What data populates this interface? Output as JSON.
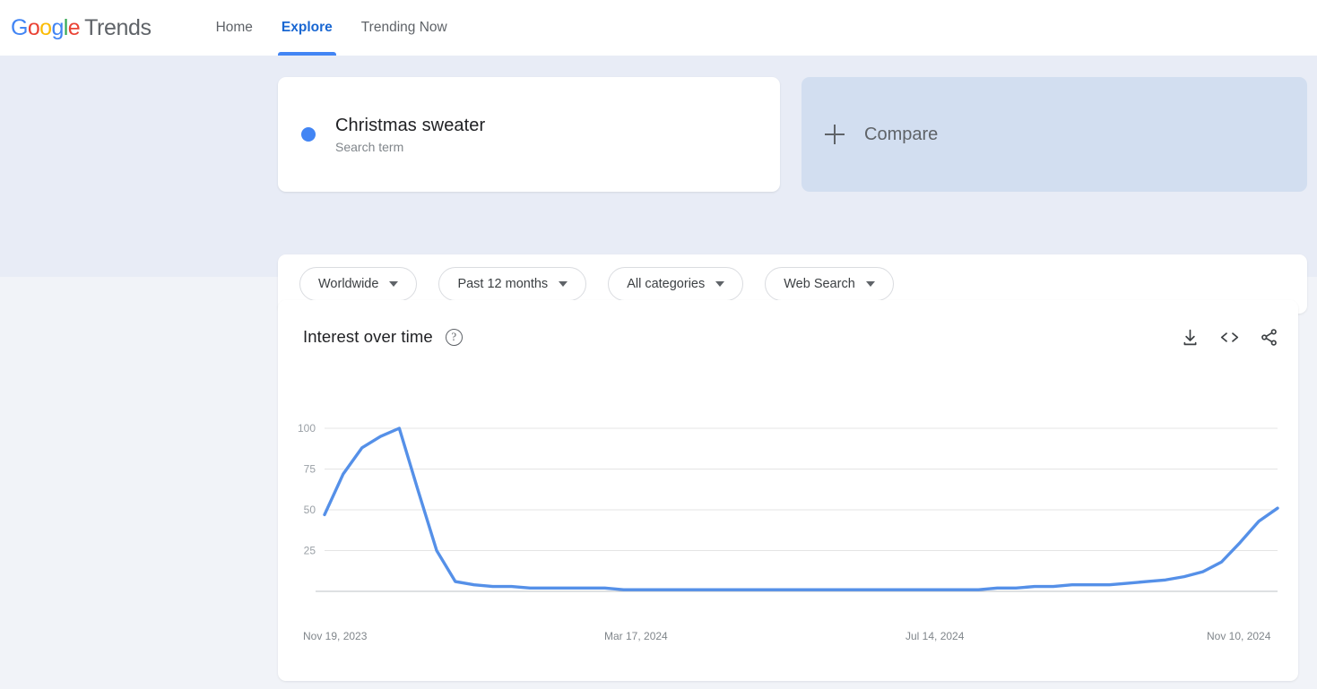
{
  "brand": {
    "logo_letters": [
      "G",
      "o",
      "o",
      "g",
      "l",
      "e"
    ],
    "word": "Trends"
  },
  "nav": {
    "items": [
      {
        "label": "Home",
        "active": false
      },
      {
        "label": "Explore",
        "active": true
      },
      {
        "label": "Trending Now",
        "active": false
      }
    ]
  },
  "query": {
    "term": {
      "title": "Christmas sweater",
      "subtitle": "Search term",
      "dot_color": "#4285f4"
    },
    "compare": {
      "label": "Compare",
      "icon": "plus-icon"
    }
  },
  "filters": [
    {
      "label": "Worldwide"
    },
    {
      "label": "Past 12 months"
    },
    {
      "label": "All categories"
    },
    {
      "label": "Web Search"
    }
  ],
  "chart_card": {
    "title": "Interest over time",
    "help_icon": "?",
    "actions": [
      {
        "name": "download-icon"
      },
      {
        "name": "embed-icon"
      },
      {
        "name": "share-icon"
      }
    ]
  },
  "chart_data": {
    "type": "line",
    "title": "Interest over time",
    "xlabel": "",
    "ylabel": "",
    "ylim": [
      0,
      100
    ],
    "yticks": [
      25,
      50,
      75,
      100
    ],
    "grid": true,
    "legend": false,
    "line_color": "#5590e8",
    "xticks": [
      "Nov 19, 2023",
      "Mar 17, 2024",
      "Jul 14, 2024",
      "Nov 10, 2024"
    ],
    "series": [
      {
        "name": "Christmas sweater",
        "color": "#5590e8",
        "x": [
          "Nov 19, 2023",
          "Nov 26, 2023",
          "Dec 3, 2023",
          "Dec 10, 2023",
          "Dec 17, 2023",
          "Dec 24, 2023",
          "Dec 31, 2023",
          "Jan 7, 2024",
          "Jan 14, 2024",
          "Jan 21, 2024",
          "Jan 28, 2024",
          "Feb 4, 2024",
          "Feb 11, 2024",
          "Feb 18, 2024",
          "Feb 25, 2024",
          "Mar 3, 2024",
          "Mar 10, 2024",
          "Mar 17, 2024",
          "Mar 24, 2024",
          "Mar 31, 2024",
          "Apr 7, 2024",
          "Apr 14, 2024",
          "Apr 21, 2024",
          "Apr 28, 2024",
          "May 5, 2024",
          "May 12, 2024",
          "May 19, 2024",
          "May 26, 2024",
          "Jun 2, 2024",
          "Jun 9, 2024",
          "Jun 16, 2024",
          "Jun 23, 2024",
          "Jun 30, 2024",
          "Jul 7, 2024",
          "Jul 14, 2024",
          "Jul 21, 2024",
          "Jul 28, 2024",
          "Aug 4, 2024",
          "Aug 11, 2024",
          "Aug 18, 2024",
          "Aug 25, 2024",
          "Sep 1, 2024",
          "Sep 8, 2024",
          "Sep 15, 2024",
          "Sep 22, 2024",
          "Sep 29, 2024",
          "Oct 6, 2024",
          "Oct 13, 2024",
          "Oct 20, 2024",
          "Oct 27, 2024",
          "Nov 3, 2024",
          "Nov 10, 2024"
        ],
        "values": [
          47,
          72,
          88,
          95,
          100,
          62,
          25,
          6,
          4,
          3,
          3,
          2,
          2,
          2,
          2,
          2,
          1,
          1,
          1,
          1,
          1,
          1,
          1,
          1,
          1,
          1,
          1,
          1,
          1,
          1,
          1,
          1,
          1,
          1,
          1,
          1,
          2,
          2,
          3,
          3,
          4,
          4,
          4,
          5,
          6,
          7,
          9,
          12,
          18,
          30,
          43,
          51
        ]
      }
    ]
  }
}
